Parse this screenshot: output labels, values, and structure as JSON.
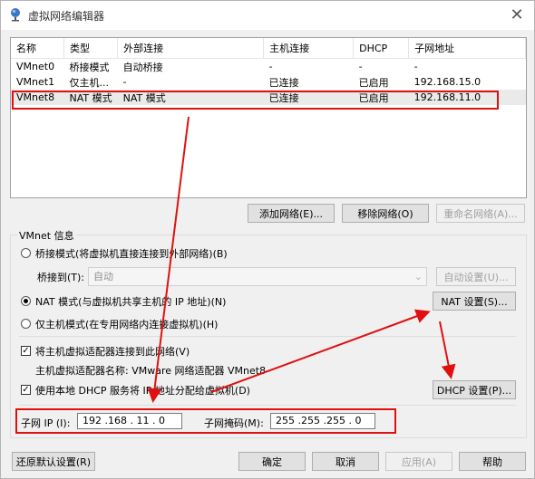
{
  "window": {
    "title": "虚拟网络编辑器",
    "close_glyph": "✕"
  },
  "table": {
    "columns": [
      "名称",
      "类型",
      "外部连接",
      "主机连接",
      "DHCP",
      "子网地址"
    ],
    "rows": [
      [
        "VMnet0",
        "桥接模式",
        "自动桥接",
        "-",
        "-",
        "-"
      ],
      [
        "VMnet1",
        "仅主机...",
        "-",
        "已连接",
        "已启用",
        "192.168.15.0"
      ],
      [
        "VMnet8",
        "NAT 模式",
        "NAT 模式",
        "已连接",
        "已启用",
        "192.168.11.0"
      ]
    ],
    "selected_row": 2
  },
  "network_buttons": {
    "add": "添加网络(E)...",
    "remove": "移除网络(O)",
    "rename": "重命名网络(A)..."
  },
  "vmnet_info": {
    "group_title": "VMnet 信息",
    "bridged_label": "桥接模式(将虚拟机直接连接到外部网络)(B)",
    "bridge_to_label": "桥接到(T):",
    "bridge_to_value": "自动",
    "auto_settings": "自动设置(U)...",
    "nat_label": "NAT 模式(与虚拟机共享主机的 IP 地址)(N)",
    "nat_settings": "NAT 设置(S)...",
    "hostonly_label": "仅主机模式(在专用网络内连接虚拟机)(H)",
    "selected_mode": "nat",
    "connect_adapter_label": "将主机虚拟适配器连接到此网络(V)",
    "connect_adapter_checked": true,
    "adapter_name_label": "主机虚拟适配器名称: VMware 网络适配器 VMnet8",
    "dhcp_label": "使用本地 DHCP 服务将 IP 地址分配给虚拟机(D)",
    "dhcp_checked": true,
    "dhcp_settings": "DHCP 设置(P)...",
    "subnet_ip_label": "子网 IP (I):",
    "subnet_ip_value": "192 .168 . 11 . 0",
    "subnet_mask_label": "子网掩码(M):",
    "subnet_mask_value": "255 .255 .255 . 0"
  },
  "footer": {
    "restore": "还原默认设置(R)",
    "ok": "确定",
    "cancel": "取消",
    "apply": "应用(A)",
    "help": "帮助"
  },
  "annotation_color": "#e01010",
  "check_glyph": "✓"
}
